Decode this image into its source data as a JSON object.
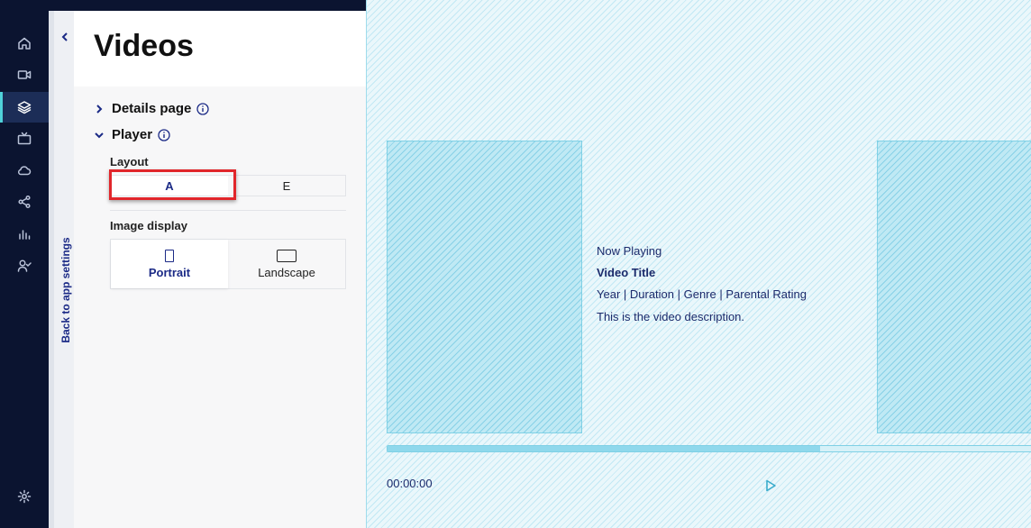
{
  "nav": {
    "items": [
      {
        "icon": "home-icon"
      },
      {
        "icon": "video-camera-icon"
      },
      {
        "icon": "layers-icon",
        "active": true
      },
      {
        "icon": "tv-icon"
      },
      {
        "icon": "cloud-icon"
      },
      {
        "icon": "share-icon"
      },
      {
        "icon": "bar-chart-icon"
      },
      {
        "icon": "user-check-icon"
      }
    ],
    "settings_icon": "gear-icon"
  },
  "back": {
    "label": "Back to app settings"
  },
  "panel": {
    "title": "Videos",
    "sections": {
      "details": {
        "label": "Details page",
        "expanded": false
      },
      "player": {
        "label": "Player",
        "expanded": true
      }
    },
    "layout": {
      "label": "Layout",
      "options": [
        "A",
        "E"
      ],
      "selected": "A"
    },
    "image_display": {
      "label": "Image display",
      "options": [
        "Portrait",
        "Landscape"
      ],
      "selected": "Portrait"
    }
  },
  "preview": {
    "now_playing": "Now Playing",
    "video_title": "Video Title",
    "meta_line": "Year | Duration | Genre | Parental Rating",
    "description": "This is the video description.",
    "time": "00:00:00",
    "progress_fraction": 0.66
  },
  "colors": {
    "rail": "#0b1430",
    "accent": "#1b2a86",
    "highlight": "#e1262b",
    "preview_text": "#1b2a6b"
  }
}
